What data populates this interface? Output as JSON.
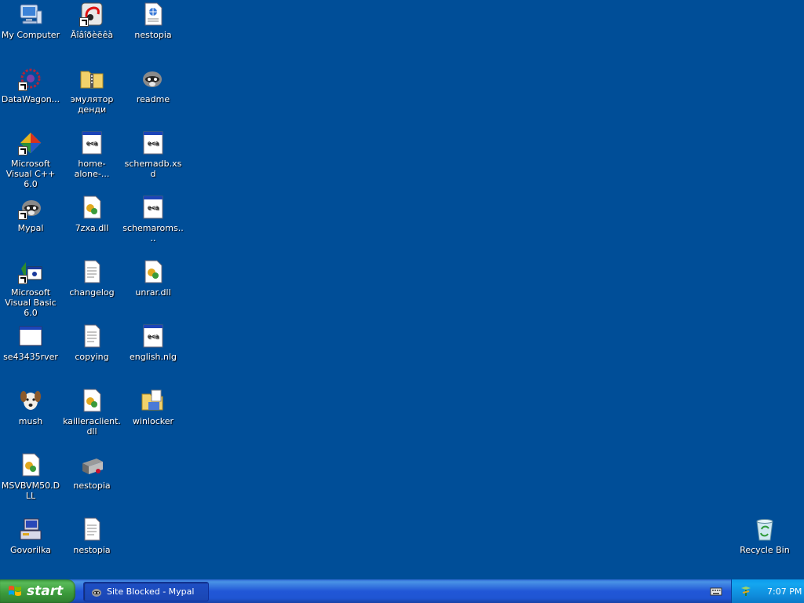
{
  "desktop": {
    "background": "#004e98",
    "icons": [
      {
        "label": "My Computer",
        "icon": "my-computer-icon"
      },
      {
        "label": "DataWagon...",
        "icon": "datawagon-icon"
      },
      {
        "label": "Microsoft Visual C++ 6.0",
        "icon": "visual-cpp-icon"
      },
      {
        "label": "Mypal",
        "icon": "mypal-raccoon-icon"
      },
      {
        "label": "Microsoft Visual Basic 6.0",
        "icon": "visual-basic-icon"
      },
      {
        "label": "se43435rver",
        "icon": "application-window-icon"
      },
      {
        "label": "mush",
        "icon": "dog-icon"
      },
      {
        "label": "MSVBVM50.DLL",
        "icon": "dll-file-icon"
      },
      {
        "label": "Govorilka",
        "icon": "govorilka-icon"
      },
      {
        "label": "Ãîâîðèëêà",
        "icon": "govorilka-shortcut-icon"
      },
      {
        "label": "эмулятор денди",
        "icon": "zip-folder-icon"
      },
      {
        "label": "home-alone-...",
        "icon": "xml-file-icon"
      },
      {
        "label": "7zxa.dll",
        "icon": "dll-file-icon"
      },
      {
        "label": "changelog",
        "icon": "text-file-icon"
      },
      {
        "label": "copying",
        "icon": "text-file-icon"
      },
      {
        "label": "kailleraclient.dll",
        "icon": "dll-file-icon"
      },
      {
        "label": "nestopia",
        "icon": "nestopia-console-icon"
      },
      {
        "label": "nestopia",
        "icon": "text-file-icon"
      },
      {
        "label": "nestopia",
        "icon": "html-file-icon"
      },
      {
        "label": "readme",
        "icon": "raccoon-document-icon"
      },
      {
        "label": "schemadb.xsd",
        "icon": "xml-file-icon"
      },
      {
        "label": "schemaroms....",
        "icon": "xml-file-icon"
      },
      {
        "label": "unrar.dll",
        "icon": "dll-file-icon"
      },
      {
        "label": "english.nlg",
        "icon": "xml-file-icon"
      },
      {
        "label": "winlocker",
        "icon": "winlocker-folder-icon"
      },
      {
        "label": "Recycle Bin",
        "icon": "recycle-bin-icon"
      }
    ]
  },
  "taskbar": {
    "start_label": "start",
    "task_item_label": "Site Blocked - Mypal",
    "clock": "7:07 PM"
  }
}
